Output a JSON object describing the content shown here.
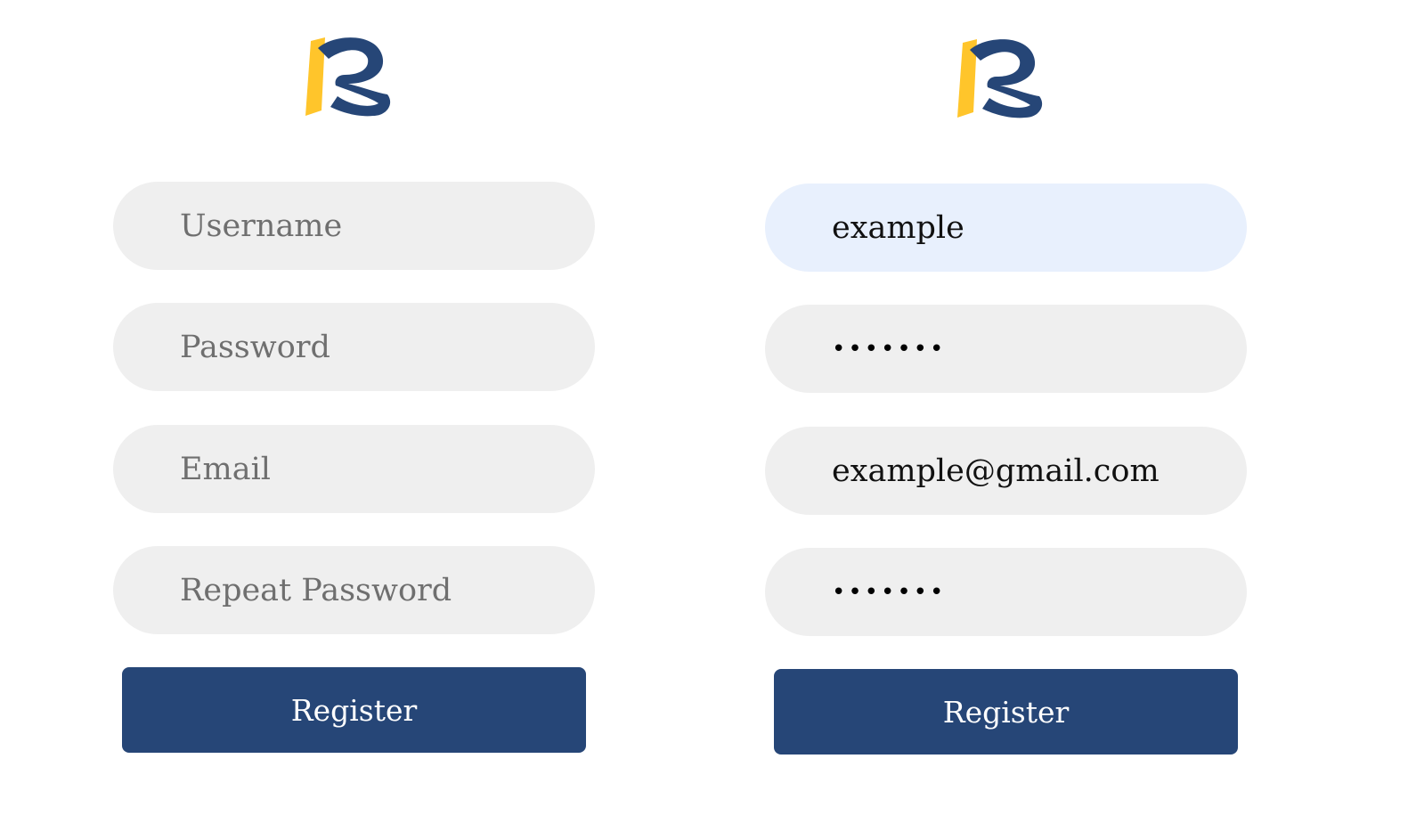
{
  "colors": {
    "brand_navy": "#264677",
    "brand_yellow": "#FFC52B",
    "field_background": "#EFEFEF",
    "autofill_background": "#E8F0FD",
    "placeholder_text": "#6F6F6F"
  },
  "logo": {
    "icon": "brand-logo-icon"
  },
  "empty_form": {
    "username_placeholder": "Username",
    "password_placeholder": "Password",
    "email_placeholder": "Email",
    "repeat_password_placeholder": "Repeat Password",
    "register_label": "Register"
  },
  "filled_form": {
    "username_value": "example",
    "password_value": "•••••••",
    "email_value": "example@gmail.com",
    "repeat_password_value": "•••••••",
    "register_label": "Register"
  }
}
